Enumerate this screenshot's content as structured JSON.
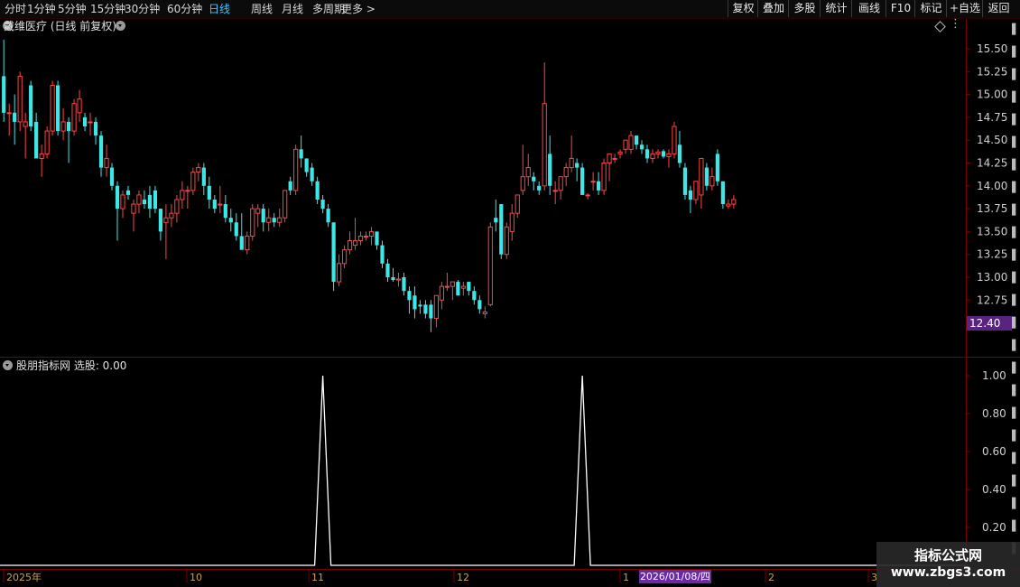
{
  "toolbar": {
    "periods": [
      "分时",
      "1分钟",
      "5分钟",
      "15分钟",
      "30分钟",
      "60分钟",
      "日线",
      "周线",
      "月线",
      "多周期",
      "更多 >"
    ],
    "active_period": "日线",
    "buttons": [
      "复权",
      "叠加",
      "多股",
      "统计",
      "画线",
      "F10",
      "标记",
      "+自选",
      "返回"
    ]
  },
  "main_title": "戴维医疗 (日线 前复权)",
  "indicator_title": "股朋指标网 选股: 0.00",
  "price_axis": {
    "ticks": [
      "15.50",
      "15.25",
      "15.00",
      "14.75",
      "14.50",
      "14.25",
      "14.00",
      "13.75",
      "13.50",
      "13.25",
      "13.00",
      "12.75"
    ],
    "current_label": "12.40"
  },
  "indicator_axis": {
    "ticks": [
      "1.00",
      "0.80",
      "0.60",
      "0.40",
      "0.20"
    ]
  },
  "date_axis": {
    "labels": [
      "2025年",
      "10",
      "11",
      "12",
      "1",
      "2",
      "3"
    ],
    "cursor_label": "2026/01/08/四"
  },
  "watermark": {
    "line1": "指标公式网",
    "line2": "www.zbgs3.com"
  },
  "colors": {
    "up": "#ff4444",
    "down": "#3fe6e6",
    "grid": "#7a0000",
    "signal": "#ffffff",
    "active_period": "#3fc8ff",
    "cursor_tag": "#6a2aa8",
    "price_tag": "#5a2380"
  },
  "chart_data": {
    "type": "candlestick",
    "price_range": [
      12.4,
      15.6
    ],
    "indicator_range": [
      0,
      1
    ],
    "candles": [
      {
        "o": 15.2,
        "h": 15.6,
        "l": 14.7,
        "c": 14.8
      },
      {
        "o": 14.8,
        "h": 14.9,
        "l": 14.55,
        "c": 14.8
      },
      {
        "o": 14.8,
        "h": 15.0,
        "l": 14.45,
        "c": 14.7
      },
      {
        "o": 14.7,
        "h": 15.25,
        "l": 14.6,
        "c": 15.2
      },
      {
        "o": 14.65,
        "h": 14.8,
        "l": 14.3,
        "c": 14.7
      },
      {
        "o": 15.1,
        "h": 15.15,
        "l": 14.6,
        "c": 14.65
      },
      {
        "o": 14.7,
        "h": 14.8,
        "l": 14.3,
        "c": 14.3
      },
      {
        "o": 14.3,
        "h": 14.45,
        "l": 14.1,
        "c": 14.35
      },
      {
        "o": 14.35,
        "h": 14.65,
        "l": 14.3,
        "c": 14.6
      },
      {
        "o": 14.6,
        "h": 15.15,
        "l": 14.55,
        "c": 15.1
      },
      {
        "o": 15.1,
        "h": 15.15,
        "l": 14.55,
        "c": 14.6
      },
      {
        "o": 14.6,
        "h": 14.85,
        "l": 14.5,
        "c": 14.7
      },
      {
        "o": 14.7,
        "h": 14.75,
        "l": 14.25,
        "c": 14.6
      },
      {
        "o": 14.6,
        "h": 14.95,
        "l": 14.55,
        "c": 14.9
      },
      {
        "o": 14.8,
        "h": 15.05,
        "l": 14.7,
        "c": 14.95
      },
      {
        "o": 14.75,
        "h": 14.8,
        "l": 14.6,
        "c": 14.65
      },
      {
        "o": 14.7,
        "h": 14.8,
        "l": 14.55,
        "c": 14.7
      },
      {
        "o": 14.7,
        "h": 14.75,
        "l": 14.45,
        "c": 14.55
      },
      {
        "o": 14.55,
        "h": 14.6,
        "l": 14.1,
        "c": 14.2
      },
      {
        "o": 14.2,
        "h": 14.45,
        "l": 14.1,
        "c": 14.3
      },
      {
        "o": 14.2,
        "h": 14.25,
        "l": 13.95,
        "c": 14.0
      },
      {
        "o": 14.0,
        "h": 14.05,
        "l": 13.4,
        "c": 13.75
      },
      {
        "o": 13.75,
        "h": 13.95,
        "l": 13.65,
        "c": 13.9
      },
      {
        "o": 13.95,
        "h": 14.0,
        "l": 13.85,
        "c": 13.9
      },
      {
        "o": 13.7,
        "h": 13.85,
        "l": 13.5,
        "c": 13.8
      },
      {
        "o": 13.8,
        "h": 13.95,
        "l": 13.7,
        "c": 13.9
      },
      {
        "o": 13.85,
        "h": 13.95,
        "l": 13.75,
        "c": 13.8
      },
      {
        "o": 13.9,
        "h": 14.0,
        "l": 13.65,
        "c": 13.75
      },
      {
        "o": 13.95,
        "h": 14.0,
        "l": 13.7,
        "c": 13.75
      },
      {
        "o": 13.75,
        "h": 13.75,
        "l": 13.4,
        "c": 13.5
      },
      {
        "o": 13.6,
        "h": 13.8,
        "l": 13.2,
        "c": 13.65
      },
      {
        "o": 13.65,
        "h": 13.8,
        "l": 13.55,
        "c": 13.7
      },
      {
        "o": 13.7,
        "h": 13.9,
        "l": 13.6,
        "c": 13.85
      },
      {
        "o": 13.85,
        "h": 14.05,
        "l": 13.75,
        "c": 13.95
      },
      {
        "o": 13.95,
        "h": 14.0,
        "l": 13.75,
        "c": 13.95
      },
      {
        "o": 13.95,
        "h": 14.2,
        "l": 13.9,
        "c": 14.15
      },
      {
        "o": 14.15,
        "h": 14.25,
        "l": 14.05,
        "c": 14.2
      },
      {
        "o": 14.2,
        "h": 14.25,
        "l": 13.9,
        "c": 14.0
      },
      {
        "o": 14.0,
        "h": 14.1,
        "l": 13.75,
        "c": 13.85
      },
      {
        "o": 13.85,
        "h": 13.9,
        "l": 13.7,
        "c": 13.75
      },
      {
        "o": 13.8,
        "h": 14.0,
        "l": 13.7,
        "c": 13.8
      },
      {
        "o": 13.8,
        "h": 13.9,
        "l": 13.6,
        "c": 13.65
      },
      {
        "o": 13.65,
        "h": 13.75,
        "l": 13.5,
        "c": 13.6
      },
      {
        "o": 13.6,
        "h": 13.7,
        "l": 13.4,
        "c": 13.45
      },
      {
        "o": 13.45,
        "h": 13.7,
        "l": 13.3,
        "c": 13.3
      },
      {
        "o": 13.3,
        "h": 13.5,
        "l": 13.25,
        "c": 13.45
      },
      {
        "o": 13.45,
        "h": 13.8,
        "l": 13.4,
        "c": 13.75
      },
      {
        "o": 13.7,
        "h": 13.8,
        "l": 13.55,
        "c": 13.75
      },
      {
        "o": 13.75,
        "h": 13.8,
        "l": 13.5,
        "c": 13.6
      },
      {
        "o": 13.6,
        "h": 13.75,
        "l": 13.5,
        "c": 13.65
      },
      {
        "o": 13.65,
        "h": 13.7,
        "l": 13.55,
        "c": 13.6
      },
      {
        "o": 13.6,
        "h": 13.75,
        "l": 13.55,
        "c": 13.65
      },
      {
        "o": 13.65,
        "h": 13.95,
        "l": 13.6,
        "c": 13.95
      },
      {
        "o": 14.05,
        "h": 14.1,
        "l": 13.9,
        "c": 13.95
      },
      {
        "o": 13.95,
        "h": 14.45,
        "l": 13.9,
        "c": 14.4
      },
      {
        "o": 14.4,
        "h": 14.55,
        "l": 14.2,
        "c": 14.3
      },
      {
        "o": 14.3,
        "h": 14.3,
        "l": 14.1,
        "c": 14.15
      },
      {
        "o": 14.2,
        "h": 14.25,
        "l": 14.0,
        "c": 14.05
      },
      {
        "o": 14.05,
        "h": 14.1,
        "l": 13.8,
        "c": 13.85
      },
      {
        "o": 13.85,
        "h": 13.9,
        "l": 13.7,
        "c": 13.75
      },
      {
        "o": 13.75,
        "h": 13.8,
        "l": 13.55,
        "c": 13.6
      },
      {
        "o": 13.6,
        "h": 13.6,
        "l": 12.85,
        "c": 12.95
      },
      {
        "o": 12.95,
        "h": 13.25,
        "l": 12.9,
        "c": 13.15
      },
      {
        "o": 13.15,
        "h": 13.35,
        "l": 13.1,
        "c": 13.3
      },
      {
        "o": 13.3,
        "h": 13.5,
        "l": 13.25,
        "c": 13.4
      },
      {
        "o": 13.35,
        "h": 13.65,
        "l": 13.3,
        "c": 13.4
      },
      {
        "o": 13.4,
        "h": 13.5,
        "l": 13.35,
        "c": 13.45
      },
      {
        "o": 13.45,
        "h": 13.5,
        "l": 13.4,
        "c": 13.45
      },
      {
        "o": 13.45,
        "h": 13.55,
        "l": 13.35,
        "c": 13.5
      },
      {
        "o": 13.5,
        "h": 13.5,
        "l": 13.3,
        "c": 13.35
      },
      {
        "o": 13.35,
        "h": 13.4,
        "l": 13.1,
        "c": 13.15
      },
      {
        "o": 13.15,
        "h": 13.2,
        "l": 12.95,
        "c": 13.0
      },
      {
        "o": 13.0,
        "h": 13.1,
        "l": 12.95,
        "c": 12.97
      },
      {
        "o": 12.97,
        "h": 13.05,
        "l": 12.9,
        "c": 12.98
      },
      {
        "o": 13.0,
        "h": 13.05,
        "l": 12.8,
        "c": 12.85
      },
      {
        "o": 12.85,
        "h": 12.9,
        "l": 12.6,
        "c": 12.75
      },
      {
        "o": 12.8,
        "h": 12.9,
        "l": 12.55,
        "c": 12.65
      },
      {
        "o": 12.7,
        "h": 12.75,
        "l": 12.6,
        "c": 12.68
      },
      {
        "o": 12.7,
        "h": 12.75,
        "l": 12.55,
        "c": 12.6
      },
      {
        "o": 12.7,
        "h": 12.75,
        "l": 12.4,
        "c": 12.55
      },
      {
        "o": 12.55,
        "h": 12.8,
        "l": 12.45,
        "c": 12.8
      },
      {
        "o": 12.75,
        "h": 12.95,
        "l": 12.65,
        "c": 12.9
      },
      {
        "o": 12.9,
        "h": 13.05,
        "l": 12.85,
        "c": 12.9
      },
      {
        "o": 12.9,
        "h": 12.95,
        "l": 12.75,
        "c": 12.95
      },
      {
        "o": 12.95,
        "h": 12.97,
        "l": 12.8,
        "c": 12.8
      },
      {
        "o": 12.88,
        "h": 12.95,
        "l": 12.8,
        "c": 12.9
      },
      {
        "o": 12.95,
        "h": 12.95,
        "l": 12.8,
        "c": 12.85
      },
      {
        "o": 12.85,
        "h": 12.9,
        "l": 12.7,
        "c": 12.75
      },
      {
        "o": 12.75,
        "h": 12.8,
        "l": 12.6,
        "c": 12.65
      },
      {
        "o": 12.6,
        "h": 12.68,
        "l": 12.55,
        "c": 12.62
      },
      {
        "o": 12.7,
        "h": 13.6,
        "l": 12.68,
        "c": 13.55
      },
      {
        "o": 13.65,
        "h": 13.85,
        "l": 13.5,
        "c": 13.6
      },
      {
        "o": 13.8,
        "h": 13.8,
        "l": 13.2,
        "c": 13.25
      },
      {
        "o": 13.25,
        "h": 13.6,
        "l": 13.2,
        "c": 13.55
      },
      {
        "o": 13.5,
        "h": 13.8,
        "l": 13.4,
        "c": 13.7
      },
      {
        "o": 13.7,
        "h": 13.9,
        "l": 13.65,
        "c": 13.9
      },
      {
        "o": 13.95,
        "h": 14.45,
        "l": 13.9,
        "c": 14.1
      },
      {
        "o": 14.1,
        "h": 14.35,
        "l": 14.0,
        "c": 14.2
      },
      {
        "o": 14.1,
        "h": 14.15,
        "l": 13.95,
        "c": 14.05
      },
      {
        "o": 14.0,
        "h": 14.05,
        "l": 13.9,
        "c": 13.95
      },
      {
        "o": 14.0,
        "h": 15.35,
        "l": 13.95,
        "c": 14.9
      },
      {
        "o": 14.35,
        "h": 14.55,
        "l": 13.9,
        "c": 14.0
      },
      {
        "o": 13.95,
        "h": 14.05,
        "l": 13.8,
        "c": 13.95
      },
      {
        "o": 13.95,
        "h": 14.1,
        "l": 13.85,
        "c": 14.1
      },
      {
        "o": 14.1,
        "h": 14.25,
        "l": 14.0,
        "c": 14.2
      },
      {
        "o": 14.2,
        "h": 14.55,
        "l": 14.15,
        "c": 14.3
      },
      {
        "o": 14.25,
        "h": 14.3,
        "l": 14.05,
        "c": 14.2
      },
      {
        "o": 14.2,
        "h": 14.25,
        "l": 13.9,
        "c": 13.9
      },
      {
        "o": 13.9,
        "h": 13.92,
        "l": 13.85,
        "c": 13.9
      },
      {
        "o": 14.05,
        "h": 14.15,
        "l": 13.95,
        "c": 14.05
      },
      {
        "o": 14.05,
        "h": 14.15,
        "l": 13.9,
        "c": 13.95
      },
      {
        "o": 13.95,
        "h": 14.3,
        "l": 13.9,
        "c": 14.25
      },
      {
        "o": 14.25,
        "h": 14.35,
        "l": 14.05,
        "c": 14.35
      },
      {
        "o": 14.3,
        "h": 14.35,
        "l": 14.25,
        "c": 14.3
      },
      {
        "o": 14.35,
        "h": 14.4,
        "l": 14.3,
        "c": 14.37
      },
      {
        "o": 14.4,
        "h": 14.5,
        "l": 14.35,
        "c": 14.5
      },
      {
        "o": 14.4,
        "h": 14.6,
        "l": 14.35,
        "c": 14.55
      },
      {
        "o": 14.55,
        "h": 14.55,
        "l": 14.4,
        "c": 14.45
      },
      {
        "o": 14.45,
        "h": 14.5,
        "l": 14.35,
        "c": 14.4
      },
      {
        "o": 14.4,
        "h": 14.45,
        "l": 14.25,
        "c": 14.3
      },
      {
        "o": 14.3,
        "h": 14.4,
        "l": 14.25,
        "c": 14.35
      },
      {
        "o": 14.35,
        "h": 14.4,
        "l": 14.3,
        "c": 14.37
      },
      {
        "o": 14.38,
        "h": 14.4,
        "l": 14.3,
        "c": 14.32
      },
      {
        "o": 14.32,
        "h": 14.4,
        "l": 14.2,
        "c": 14.35
      },
      {
        "o": 14.35,
        "h": 14.7,
        "l": 14.3,
        "c": 14.65
      },
      {
        "o": 14.45,
        "h": 14.6,
        "l": 14.2,
        "c": 14.25
      },
      {
        "o": 14.2,
        "h": 14.25,
        "l": 13.85,
        "c": 13.9
      },
      {
        "o": 13.95,
        "h": 14.0,
        "l": 13.7,
        "c": 13.85
      },
      {
        "o": 13.85,
        "h": 14.05,
        "l": 13.8,
        "c": 14.05
      },
      {
        "o": 13.9,
        "h": 14.3,
        "l": 13.75,
        "c": 14.3
      },
      {
        "o": 14.2,
        "h": 14.25,
        "l": 13.95,
        "c": 14.0
      },
      {
        "o": 14.0,
        "h": 14.2,
        "l": 13.95,
        "c": 14.1
      },
      {
        "o": 14.35,
        "h": 14.4,
        "l": 14.0,
        "c": 14.05
      },
      {
        "o": 14.05,
        "h": 14.05,
        "l": 13.75,
        "c": 13.8
      },
      {
        "o": 13.78,
        "h": 13.85,
        "l": 13.75,
        "c": 13.8
      },
      {
        "o": 13.8,
        "h": 13.9,
        "l": 13.75,
        "c": 13.85
      }
    ],
    "signals": [
      {
        "index": 59,
        "value": 1.0
      },
      {
        "index": 107,
        "value": 1.0
      }
    ]
  }
}
